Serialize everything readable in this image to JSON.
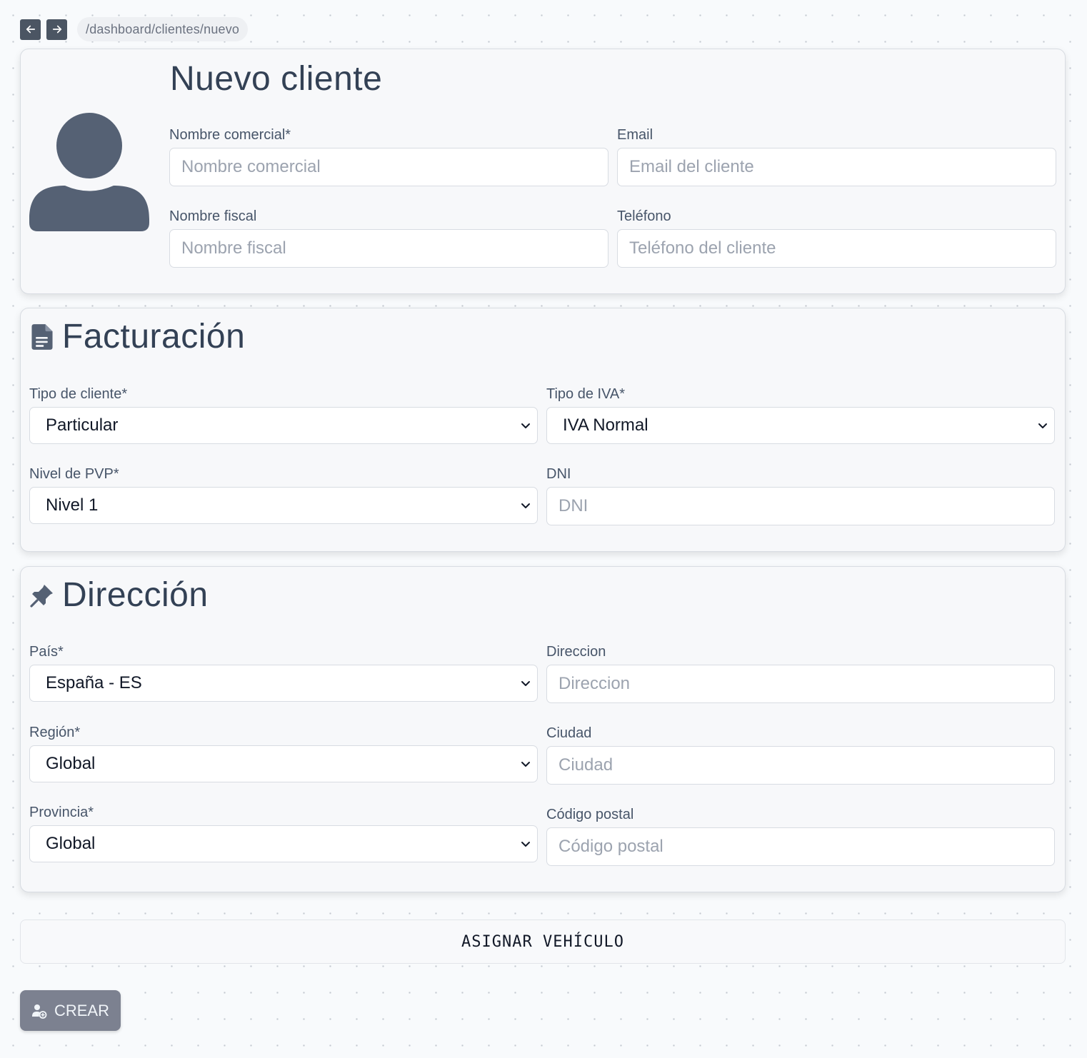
{
  "nav": {
    "back_icon": "arrow-left-icon",
    "forward_icon": "arrow-right-icon",
    "path": "/dashboard/clientes/nuevo"
  },
  "general": {
    "title": "Nuevo cliente",
    "avatar_icon": "user-avatar-icon",
    "nombre_comercial": {
      "label": "Nombre comercial*",
      "placeholder": "Nombre comercial",
      "value": ""
    },
    "email": {
      "label": "Email",
      "placeholder": "Email del cliente",
      "value": ""
    },
    "nombre_fiscal": {
      "label": "Nombre fiscal",
      "placeholder": "Nombre fiscal",
      "value": ""
    },
    "telefono": {
      "label": "Teléfono",
      "placeholder": "Teléfono del cliente",
      "value": ""
    }
  },
  "billing": {
    "title": "Facturación",
    "icon": "document-icon",
    "tipo_cliente": {
      "label": "Tipo de cliente*",
      "value": "Particular"
    },
    "tipo_iva": {
      "label": "Tipo de IVA*",
      "value": "IVA Normal"
    },
    "nivel_pvp": {
      "label": "Nivel de PVP*",
      "value": "Nivel 1"
    },
    "dni": {
      "label": "DNI",
      "placeholder": "DNI",
      "value": ""
    }
  },
  "address": {
    "title": "Dirección",
    "icon": "pushpin-icon",
    "pais": {
      "label": "País*",
      "value": "España - ES"
    },
    "direccion": {
      "label": "Direccion",
      "placeholder": "Direccion",
      "value": ""
    },
    "region": {
      "label": "Región*",
      "value": "Global"
    },
    "ciudad": {
      "label": "Ciudad",
      "placeholder": "Ciudad",
      "value": ""
    },
    "provincia": {
      "label": "Provincia*",
      "value": "Global"
    },
    "codigo_postal": {
      "label": "Código postal",
      "placeholder": "Código postal",
      "value": ""
    }
  },
  "actions": {
    "assign_vehicle_label": "ASIGNAR VEHÍCULO",
    "create_label": "CREAR",
    "create_icon": "user-add-icon"
  },
  "colors": {
    "primary_text": "#334155",
    "nav_button": "#4b5563",
    "create_button": "#7c8190",
    "placeholder": "#9ca3af"
  }
}
